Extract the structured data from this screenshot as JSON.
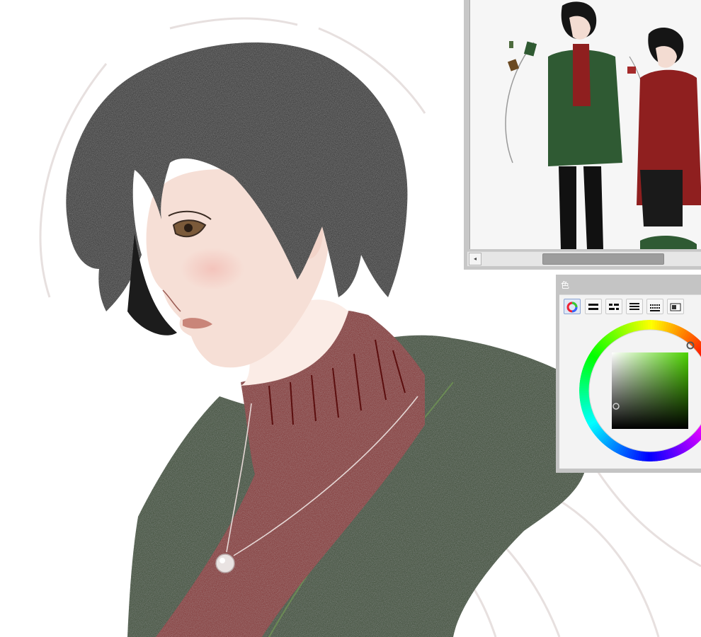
{
  "color_panel": {
    "title": "色",
    "tabs": [
      {
        "icon": "hue-circle-icon",
        "active": true
      },
      {
        "icon": "rgb-sliders-icon",
        "active": false
      },
      {
        "icon": "hsv-sliders-icon",
        "active": false
      },
      {
        "icon": "color-set-icon",
        "active": false
      },
      {
        "icon": "intermediate-color-icon",
        "active": false
      },
      {
        "icon": "approximate-color-icon",
        "active": false
      }
    ],
    "selected_hue_color": "#4cd200",
    "selected_color": "#5c6b53"
  },
  "navigator": {
    "scroll_left_glyph": "◂",
    "scroll_position": 0.4
  },
  "palette": {
    "hair": "#1c1c1c",
    "skin": "#f6dfd6",
    "sweater": "#7f1a1a",
    "jacket": "#26401f"
  }
}
